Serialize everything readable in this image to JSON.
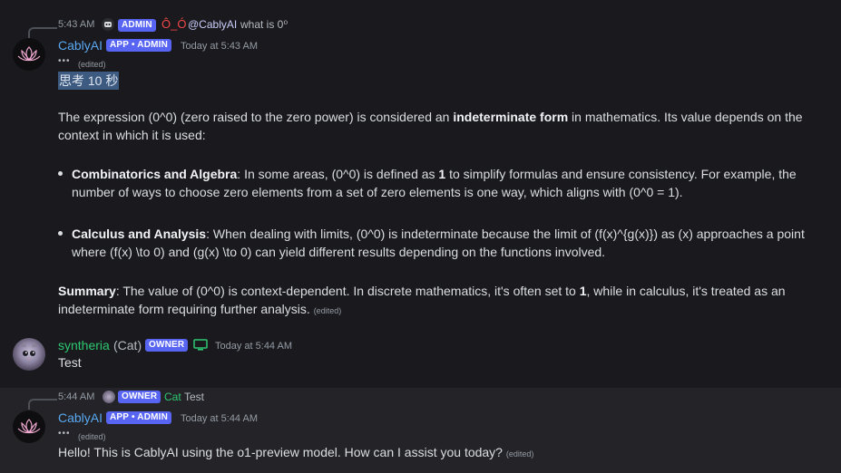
{
  "msg1": {
    "reply": {
      "time": "5:43 AM",
      "badge": "ADMIN",
      "emoticon": "Ô_Ó",
      "mention": "@CablyAI",
      "text": "what is 0⁰"
    },
    "author": "CablyAI",
    "badge": "APP • ADMIN",
    "timestamp": "Today at 5:43 AM",
    "dots": "•••",
    "edited": "(edited)",
    "highlight": "思考 10 秒",
    "intro_1": "The expression (0^0) (zero raised to the zero power) is considered an ",
    "intro_bold": "indeterminate form",
    "intro_2": " in mathematics. Its value depends on the",
    "intro_3": "context in which it is used:",
    "b1_bold": "Combinatorics and Algebra",
    "b1_1": ": In some areas, (0^0) is defined as ",
    "b1_num": "1",
    "b1_2": " to simplify formulas and ensure consistency. For example, the",
    "b1_3": "number of ways to choose zero elements from a set of zero elements is one way, which aligns with (0^0 = 1).",
    "b2_bold": "Calculus and Analysis",
    "b2_1": ": When dealing with limits, (0^0) is indeterminate because the limit of (f(x)^{g(x)}) as (x) approaches a point",
    "b2_2": "where (f(x) \\to 0) and (g(x) \\to 0) can yield different results depending on the functions involved.",
    "sum_bold": "Summary",
    "sum_1": ": The value of (0^0) is context-dependent. In discrete mathematics, it's often set to ",
    "sum_num": "1",
    "sum_2": ", while in calculus, it's treated as an",
    "sum_3": "indeterminate form requiring further analysis.",
    "sum_edited": "(edited)"
  },
  "msg2": {
    "author": "syntheria",
    "suffix": "(Cat)",
    "badge": "OWNER",
    "timestamp": "Today at 5:44 AM",
    "text": "Test"
  },
  "msg3": {
    "reply": {
      "time": "5:44 AM",
      "badge": "OWNER",
      "name": "Cat",
      "text": "Test"
    },
    "author": "CablyAI",
    "badge": "APP • ADMIN",
    "timestamp": "Today at 5:44 AM",
    "dots": "•••",
    "edited": "(edited)",
    "text": "Hello! This is CablyAI using the o1-preview model. How can I assist you today?",
    "text_edited": "(edited)"
  },
  "colors": {
    "background": "#1a1a1e",
    "badge": "#5865f2",
    "cably_name": "#59a7f0",
    "cat_name": "#2dc770",
    "emoticon": "#f04747"
  }
}
